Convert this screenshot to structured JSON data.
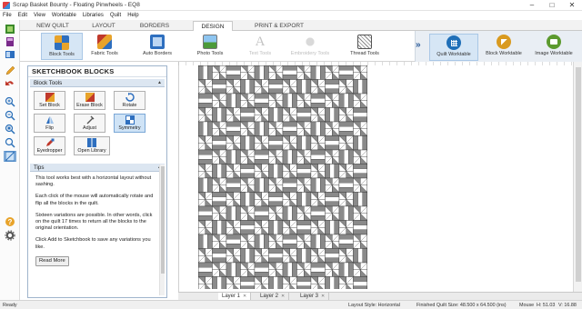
{
  "window": {
    "title": "Scrap Basket Bounty - Floating Pinwheels - EQ8"
  },
  "menu": [
    "File",
    "Edit",
    "View",
    "Worktable",
    "Libraries",
    "Quilt",
    "Help"
  ],
  "ribbon_tabs": [
    {
      "label": "NEW QUILT",
      "active": false
    },
    {
      "label": "LAYOUT",
      "active": false
    },
    {
      "label": "BORDERS",
      "active": false
    },
    {
      "label": "DESIGN",
      "active": true
    },
    {
      "label": "PRINT & EXPORT",
      "active": false
    }
  ],
  "ribbon_buttons": [
    {
      "label": "Block Tools",
      "icon": "block-tools-icon",
      "active": true,
      "enabled": true
    },
    {
      "label": "Fabric Tools",
      "icon": "fabric-tools-icon",
      "active": false,
      "enabled": true
    },
    {
      "label": "Auto Borders",
      "icon": "auto-borders-icon",
      "active": false,
      "enabled": true
    },
    {
      "label": "Photo Tools",
      "icon": "photo-tools-icon",
      "active": false,
      "enabled": true
    },
    {
      "label": "Text Tools",
      "icon": "text-tools-icon",
      "active": false,
      "enabled": false
    },
    {
      "label": "Embroidery Tools",
      "icon": "embroidery-tools-icon",
      "active": false,
      "enabled": false
    },
    {
      "label": "Thread Tools",
      "icon": "thread-tools-icon",
      "active": false,
      "enabled": true
    }
  ],
  "worktables": [
    {
      "label": "Quilt Worktable",
      "color": "#1f6fb8",
      "icon": "quilt-worktable-icon",
      "active": true
    },
    {
      "label": "Block Worktable",
      "color": "#d99a1f",
      "icon": "block-worktable-icon",
      "active": false
    },
    {
      "label": "Image Worktable",
      "color": "#5c9a2e",
      "icon": "image-worktable-icon",
      "active": false
    }
  ],
  "sketchbook": {
    "title": "SKETCHBOOK BLOCKS",
    "block_tools_header": "Block Tools",
    "tools": [
      {
        "label": "Set Block",
        "icon": "set-block-icon",
        "active": false
      },
      {
        "label": "Erase Block",
        "icon": "erase-block-icon",
        "active": false
      },
      {
        "label": "Rotate",
        "icon": "rotate-icon",
        "active": false
      },
      {
        "label": "Flip",
        "icon": "flip-icon",
        "active": false
      },
      {
        "label": "Adjust",
        "icon": "adjust-icon",
        "active": false
      },
      {
        "label": "Symmetry",
        "icon": "symmetry-icon",
        "active": true
      },
      {
        "label": "Eyedropper",
        "icon": "eyedropper-icon",
        "active": false
      },
      {
        "label": "Open Library",
        "icon": "open-library-icon",
        "active": false
      }
    ],
    "tips_header": "Tips",
    "tips": [
      "This tool works best with a horizontal layout without sashing.",
      "Each click of the mouse will automatically rotate and flip all the blocks in the quilt.",
      "Sixteen variations are possible. In other words, click on the quilt 17 times to return all the blocks to the original orientation.",
      "Click Add to Sketchbook to save any variations you like."
    ],
    "read_more": "Read More"
  },
  "layers": [
    {
      "label": "Layer 1",
      "active": true
    },
    {
      "label": "Layer 2",
      "active": false
    },
    {
      "label": "Layer 3",
      "active": false
    }
  ],
  "status": {
    "left": "Ready",
    "layout_style": "Layout Style: Horizontal",
    "finished_size": "Finished Quilt Size: 48.500 x 64.500 (ins)",
    "mouse": "Mouse",
    "h": "H: 51.03",
    "v": "V: 16.88"
  },
  "quilt": {
    "block_dark": "#8a8a8a",
    "block_light": "#ffffff",
    "line": "#333333"
  }
}
